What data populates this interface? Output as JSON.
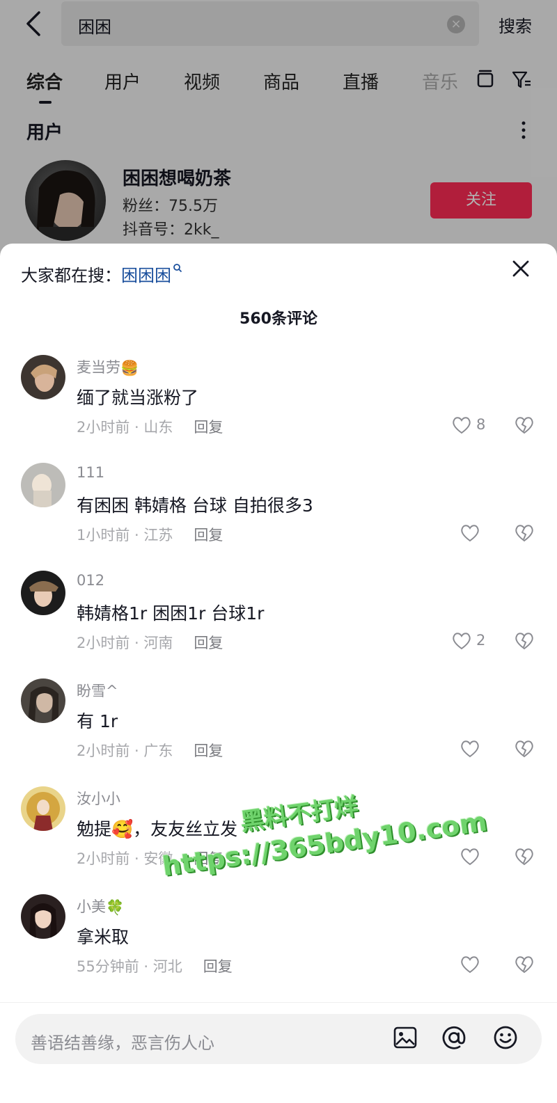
{
  "search": {
    "query": "困困",
    "search_button": "搜索"
  },
  "tabs": [
    {
      "label": "综合",
      "active": true
    },
    {
      "label": "用户"
    },
    {
      "label": "视频"
    },
    {
      "label": "商品"
    },
    {
      "label": "直播"
    },
    {
      "label": "音乐"
    }
  ],
  "user_section": {
    "title": "用户",
    "name": "困困想喝奶茶",
    "fans": "粉丝：75.5万",
    "douyin_id": "抖音号：2kk_",
    "follow_label": "关注"
  },
  "sheet": {
    "trending_prefix": "大家都在搜：",
    "trending_term": "困困困",
    "comment_count": "560条评论"
  },
  "comments": [
    {
      "name": "麦当劳",
      "name_emoji": "🍔",
      "text": "缅了就当涨粉了",
      "time": "2小时前 · 山东",
      "reply": "回复",
      "likes": "8"
    },
    {
      "name": "111",
      "text": "有困困  韩婧格 台球 自拍很多3",
      "time": "1小时前 · 江苏",
      "reply": "回复",
      "likes": ""
    },
    {
      "name": "012",
      "text": "韩婧格1r 困困1r 台球1r",
      "time": "2小时前 · 河南",
      "reply": "回复",
      "likes": "2"
    },
    {
      "name": "盼雪^",
      "text": "有  1r",
      "time": "2小时前 · 广东",
      "reply": "回复",
      "likes": ""
    },
    {
      "name": "汝小小",
      "text": "勉提🥰，友友丝立发",
      "time": "2小时前 · 安徽",
      "reply": "回复",
      "likes": ""
    },
    {
      "name": "小美",
      "name_emoji": "🍀",
      "text": "拿米取",
      "time": "55分钟前 · 河北",
      "reply": "回复",
      "likes": ""
    }
  ],
  "watermark": {
    "line1": "黑料不打烊",
    "line2": "https://365bdy10.com"
  },
  "input": {
    "placeholder": "善语结善缘，恶言伤人心"
  },
  "colors": {
    "accent": "#fe2c55",
    "link": "#1a4f9c",
    "watermark": "#6fd36c"
  }
}
